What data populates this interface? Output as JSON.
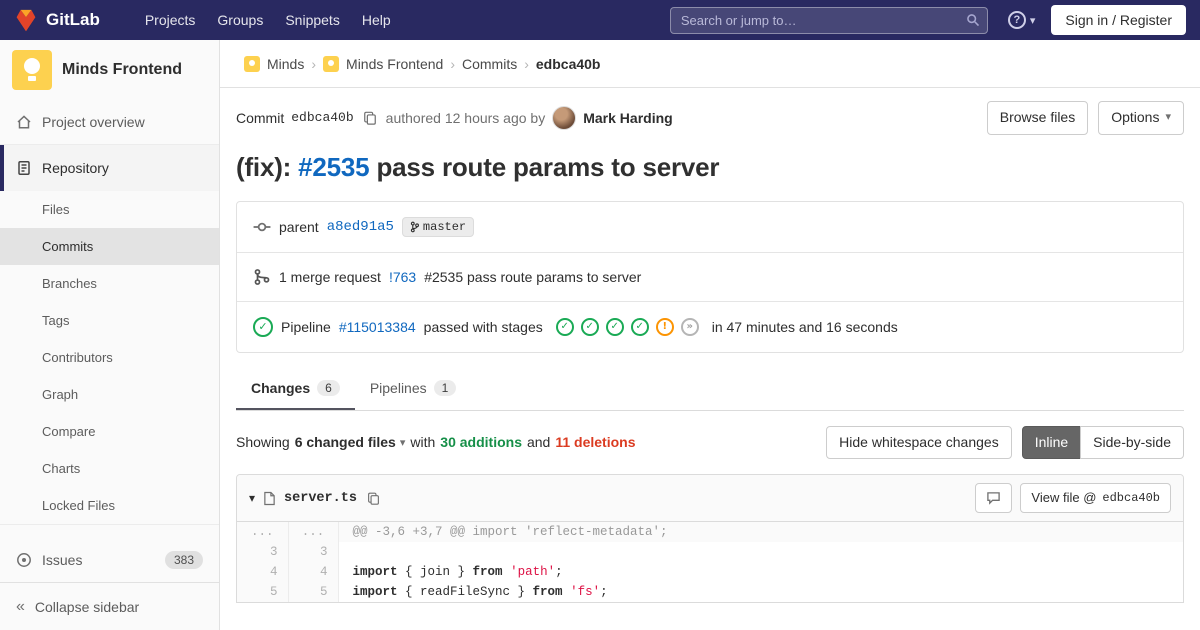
{
  "navbar": {
    "brand": "GitLab",
    "menu": [
      "Projects",
      "Groups",
      "Snippets",
      "Help"
    ],
    "search_placeholder": "Search or jump to…",
    "signin": "Sign in / Register"
  },
  "sidebar": {
    "project": "Minds Frontend",
    "project_overview": "Project overview",
    "repository": "Repository",
    "repo_items": [
      "Files",
      "Commits",
      "Branches",
      "Tags",
      "Contributors",
      "Graph",
      "Compare",
      "Charts",
      "Locked Files"
    ],
    "issues": "Issues",
    "issues_count": "383",
    "collapse": "Collapse sidebar"
  },
  "breadcrumb": [
    "Minds",
    "Minds Frontend",
    "Commits",
    "edbca40b"
  ],
  "commit": {
    "label": "Commit",
    "sha": "edbca40b",
    "authored": "authored 12 hours ago by",
    "author": "Mark Harding",
    "browse_files": "Browse files",
    "options": "Options",
    "title": {
      "prefix": "(fix): ",
      "issue": "#2535",
      "rest": " pass route params to server"
    },
    "parent": {
      "label": "parent",
      "sha": "a8ed91a5",
      "ref": "master"
    },
    "merge_request": {
      "prefix": "1 merge request",
      "link": "!763",
      "suffix": "#2535 pass route params to server"
    },
    "pipeline": {
      "prefix": "Pipeline",
      "id": "#115013384",
      "status_text": "passed with stages",
      "stages": [
        "passed",
        "passed",
        "passed",
        "passed",
        "warning",
        "skipped"
      ],
      "duration": "in 47 minutes and 16 seconds"
    }
  },
  "tabs": [
    {
      "label": "Changes",
      "count": "6"
    },
    {
      "label": "Pipelines",
      "count": "1"
    }
  ],
  "diff_toolbar": {
    "showing": "Showing",
    "files_dropdown": "6 changed files",
    "with": "with",
    "additions": "30 additions",
    "and": "and",
    "deletions": "11 deletions",
    "hide_whitespace": "Hide whitespace changes",
    "inline": "Inline",
    "side_by_side": "Side-by-side"
  },
  "diff_file": {
    "name": "server.ts",
    "view_file": "View file @",
    "view_file_sha": "edbca40b",
    "lines": [
      {
        "old": "...",
        "new": "...",
        "type": "meta",
        "tokens": [
          [
            "m",
            "@@ -3,6 +3,7 @@ import 'reflect-metadata';"
          ]
        ]
      },
      {
        "old": "3",
        "new": "3",
        "type": "context",
        "tokens": []
      },
      {
        "old": "4",
        "new": "4",
        "type": "context",
        "tokens": [
          [
            "k",
            "import"
          ],
          [
            "p",
            " { join } "
          ],
          [
            "k",
            "from"
          ],
          [
            "p",
            " "
          ],
          [
            "s",
            "'path'"
          ],
          [
            "p",
            ";"
          ]
        ]
      },
      {
        "old": "5",
        "new": "5",
        "type": "context",
        "tokens": [
          [
            "k",
            "import"
          ],
          [
            "p",
            " { readFileSync } "
          ],
          [
            "k",
            "from"
          ],
          [
            "p",
            " "
          ],
          [
            "s",
            "'fs'"
          ],
          [
            "p",
            ";"
          ]
        ]
      }
    ]
  },
  "colors": {
    "navbar_bg": "#292961",
    "link": "#1068bf",
    "additions_green": "#168f48",
    "deletions_red": "#db3b21",
    "ci_green": "#1aaa55",
    "ci_orange": "#fc9403",
    "ci_gray": "#b5b5b5",
    "brand_orange": "#fc6d26"
  }
}
